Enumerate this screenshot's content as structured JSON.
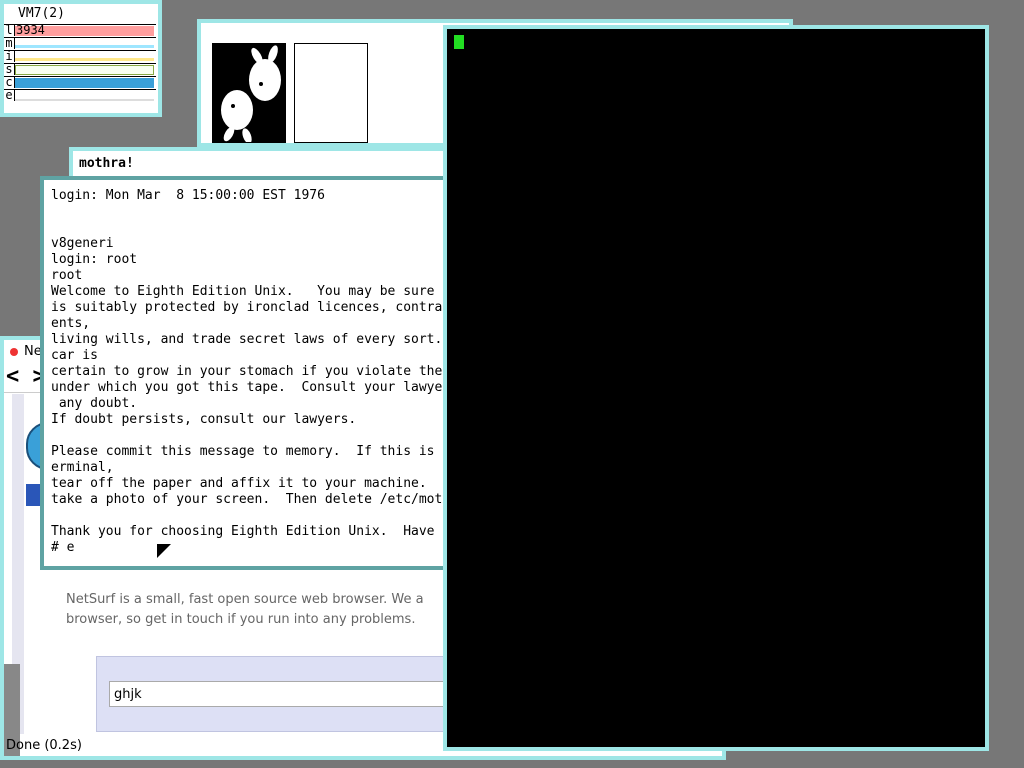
{
  "stats": {
    "title": "VM7(2)",
    "rows": [
      {
        "label": "l",
        "value": "3934",
        "color": "#ff9e9e"
      },
      {
        "label": "m",
        "value": "",
        "color": "#9ee6ff"
      },
      {
        "label": "i",
        "value": "",
        "color": "#ffe88a"
      },
      {
        "label": "s",
        "value": "",
        "color": "#b8e890"
      },
      {
        "label": "c",
        "value": "",
        "color": "#3aa0d8"
      },
      {
        "label": "e",
        "value": "",
        "color": "#dddddd"
      }
    ]
  },
  "mothra": {
    "title": "mothra!"
  },
  "netsurf": {
    "title": "Ne",
    "back_icon": "<",
    "forward_icon": ">",
    "description": "NetSurf is a small, fast open source web browser. We a browser, so get in touch if you run into any problems.",
    "search_value": "ghjk",
    "status": "Done (0.2s)"
  },
  "terminal": {
    "lines": [
      "login: Mon Mar  8 15:00:00 EST 1976",
      "",
      "",
      "v8generi",
      "login: root",
      "root",
      "Welcome to Eighth Edition Unix.   You may be sure that it",
      "is suitably protected by ironclad licences, contractual agreem",
      "ents,",
      "living wills, and trade secret laws of every sort.  A trolley",
      "car is",
      "certain to grow in your stomach if you violate the conditions",
      "under which you got this tape.  Consult your lawyer in case of",
      " any doubt.",
      "If doubt persists, consult our lawyers.",
      "",
      "Please commit this message to memory.  If this is a hardcopy t",
      "erminal,",
      "tear off the paper and affix it to your machine.  Otherwise",
      "take a photo of your screen.  Then delete /etc/motd.",
      "",
      "Thank you for choosing Eighth Edition Unix.  Have a nice day.",
      "# e"
    ]
  },
  "colors": {
    "desktop": "#777777",
    "window_border": "#9ee6e6",
    "active_border": "#5fa3a3",
    "cursor": "#22dd22"
  }
}
